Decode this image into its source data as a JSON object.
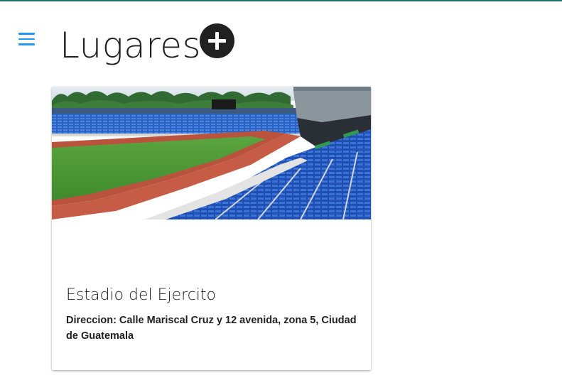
{
  "header": {
    "title": "Lugares",
    "menu_icon": "hamburger-menu-icon",
    "add_icon": "plus-circle-icon"
  },
  "colors": {
    "menu_accent": "#2196f3",
    "top_line": "#1f6b6a",
    "text": "#212121"
  },
  "places": [
    {
      "name": "Estadio del Ejercito",
      "address": "Direccion: Calle Mariscal Cruz y 12 avenida, zona 5, Ciudad de Guatemala",
      "image_icon": "stadium-photo"
    }
  ]
}
